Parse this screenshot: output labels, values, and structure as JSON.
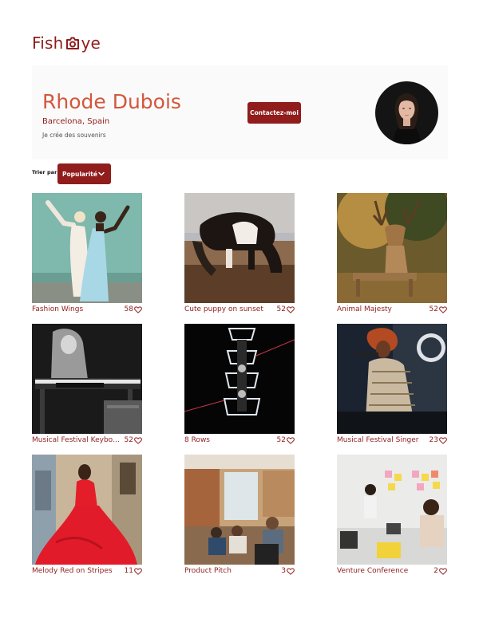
{
  "logo": {
    "text_start": "Fish",
    "text_end": "ye"
  },
  "photographer": {
    "name": "Rhode Dubois",
    "location": "Barcelona, Spain",
    "tagline": "Je crée des souvenirs"
  },
  "contact": {
    "label": "Contactez-moi"
  },
  "sort": {
    "label": "Trier par",
    "selected": "Popularité"
  },
  "colors": {
    "brand": "#901c1c",
    "accent": "#d3573c",
    "panel": "#fafafa"
  },
  "media": [
    {
      "title": "Fashion Wings",
      "likes": "58"
    },
    {
      "title": "Cute puppy on sunset",
      "likes": "52"
    },
    {
      "title": "Animal Majesty",
      "likes": "52"
    },
    {
      "title": "Musical Festival Keyboa...",
      "likes": "52"
    },
    {
      "title": "8 Rows",
      "likes": "52"
    },
    {
      "title": "Musical Festival Singer",
      "likes": "23"
    },
    {
      "title": "Melody Red on Stripes",
      "likes": "11"
    },
    {
      "title": "Product Pitch",
      "likes": "3"
    },
    {
      "title": "Venture Conference",
      "likes": "2"
    }
  ]
}
